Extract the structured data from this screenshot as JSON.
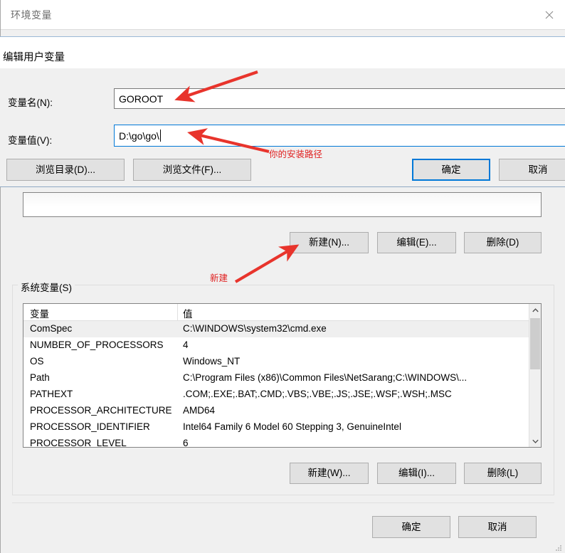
{
  "window": {
    "title": "环境变量",
    "close_icon": "close-icon"
  },
  "edit_dialog": {
    "heading": "编辑用户变量",
    "name_label": "变量名(N):",
    "name_value": "GOROOT",
    "value_label": "变量值(V):",
    "value_value": "D:\\go\\go\\",
    "browse_dir_label": "浏览目录(D)...",
    "browse_file_label": "浏览文件(F)...",
    "ok_label": "确定",
    "cancel_label": "取消"
  },
  "user_variables": {
    "new_label": "新建(N)...",
    "edit_label": "编辑(E)...",
    "delete_label": "删除(D)"
  },
  "system_variables": {
    "group_label": "系统变量(S)",
    "columns": [
      "变量",
      "值"
    ],
    "rows": [
      {
        "name": "ComSpec",
        "value": "C:\\WINDOWS\\system32\\cmd.exe",
        "selected": true
      },
      {
        "name": "NUMBER_OF_PROCESSORS",
        "value": "4",
        "selected": false
      },
      {
        "name": "OS",
        "value": "Windows_NT",
        "selected": false
      },
      {
        "name": "Path",
        "value": "C:\\Program Files (x86)\\Common Files\\NetSarang;C:\\WINDOWS\\...",
        "selected": false
      },
      {
        "name": "PATHEXT",
        "value": ".COM;.EXE;.BAT;.CMD;.VBS;.VBE;.JS;.JSE;.WSF;.WSH;.MSC",
        "selected": false
      },
      {
        "name": "PROCESSOR_ARCHITECTURE",
        "value": "AMD64",
        "selected": false
      },
      {
        "name": "PROCESSOR_IDENTIFIER",
        "value": "Intel64 Family 6 Model 60 Stepping 3, GenuineIntel",
        "selected": false
      },
      {
        "name": "PROCESSOR_LEVEL",
        "value": "6",
        "selected": false
      }
    ],
    "new_label": "新建(W)...",
    "edit_label": "编辑(I)...",
    "delete_label": "删除(L)"
  },
  "dialog_footer": {
    "ok_label": "确定",
    "cancel_label": "取消"
  },
  "annotations": {
    "install_path_note": "你的安装路径",
    "new_note": "新建",
    "arrow_color": "#e8342c"
  }
}
